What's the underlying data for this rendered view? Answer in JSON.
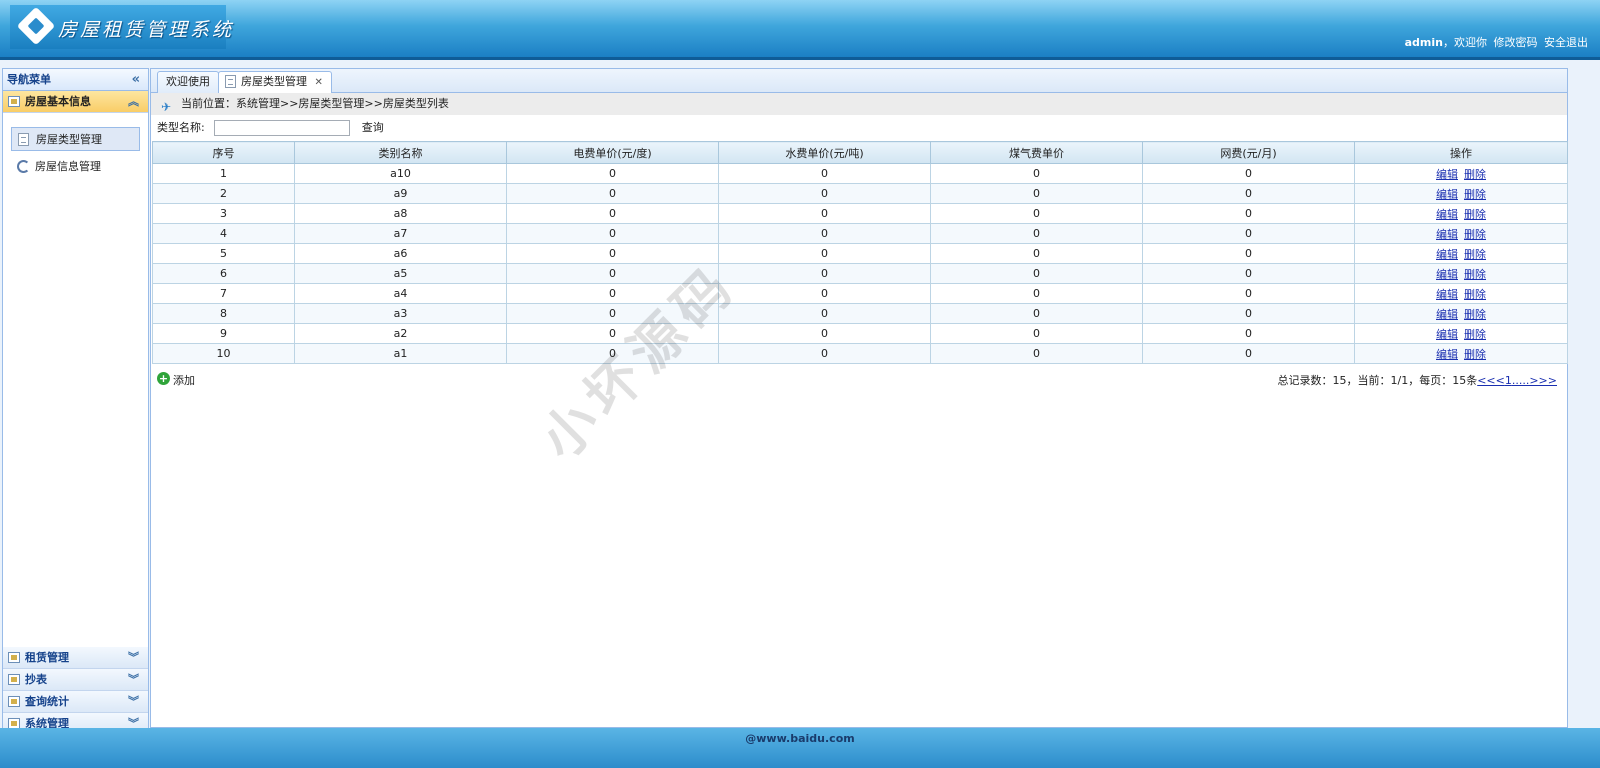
{
  "header": {
    "app_title": "房屋租赁管理系统",
    "username": "admin",
    "greeting": "，欢迎你",
    "change_password": "修改密码",
    "logout": "安全退出"
  },
  "sidebar": {
    "title": "导航菜单",
    "open_section": "房屋基本信息",
    "items": [
      {
        "label": "房屋类型管理"
      },
      {
        "label": "房屋信息管理"
      }
    ],
    "sections": [
      {
        "label": "租赁管理"
      },
      {
        "label": "抄表"
      },
      {
        "label": "查询统计"
      },
      {
        "label": "系统管理"
      }
    ]
  },
  "tabs": [
    {
      "label": "欢迎使用"
    },
    {
      "label": "房屋类型管理"
    }
  ],
  "breadcrumb": "当前位置：系统管理>>房屋类型管理>>房屋类型列表",
  "search": {
    "label": "类型名称:",
    "value": "",
    "button": "查询"
  },
  "table": {
    "headers": [
      "序号",
      "类别名称",
      "电费单价(元/度)",
      "水费单价(元/吨)",
      "煤气费单价",
      "网费(元/月)",
      "操作"
    ],
    "edit_label": "编辑",
    "delete_label": "删除",
    "rows": [
      {
        "no": "1",
        "name": "a10",
        "elec": "0",
        "water": "0",
        "gas": "0",
        "net": "0"
      },
      {
        "no": "2",
        "name": "a9",
        "elec": "0",
        "water": "0",
        "gas": "0",
        "net": "0"
      },
      {
        "no": "3",
        "name": "a8",
        "elec": "0",
        "water": "0",
        "gas": "0",
        "net": "0"
      },
      {
        "no": "4",
        "name": "a7",
        "elec": "0",
        "water": "0",
        "gas": "0",
        "net": "0"
      },
      {
        "no": "5",
        "name": "a6",
        "elec": "0",
        "water": "0",
        "gas": "0",
        "net": "0"
      },
      {
        "no": "6",
        "name": "a5",
        "elec": "0",
        "water": "0",
        "gas": "0",
        "net": "0"
      },
      {
        "no": "7",
        "name": "a4",
        "elec": "0",
        "water": "0",
        "gas": "0",
        "net": "0"
      },
      {
        "no": "8",
        "name": "a3",
        "elec": "0",
        "water": "0",
        "gas": "0",
        "net": "0"
      },
      {
        "no": "9",
        "name": "a2",
        "elec": "0",
        "water": "0",
        "gas": "0",
        "net": "0"
      },
      {
        "no": "10",
        "name": "a1",
        "elec": "0",
        "water": "0",
        "gas": "0",
        "net": "0"
      }
    ]
  },
  "add_label": "添加",
  "pager": {
    "summary": "总记录数：15，当前：1/1，每页：15条",
    "prev": "<<<",
    "current": "1",
    "next": ".....>>>"
  },
  "watermark": "小坏源码",
  "footer": "@www.baidu.com"
}
